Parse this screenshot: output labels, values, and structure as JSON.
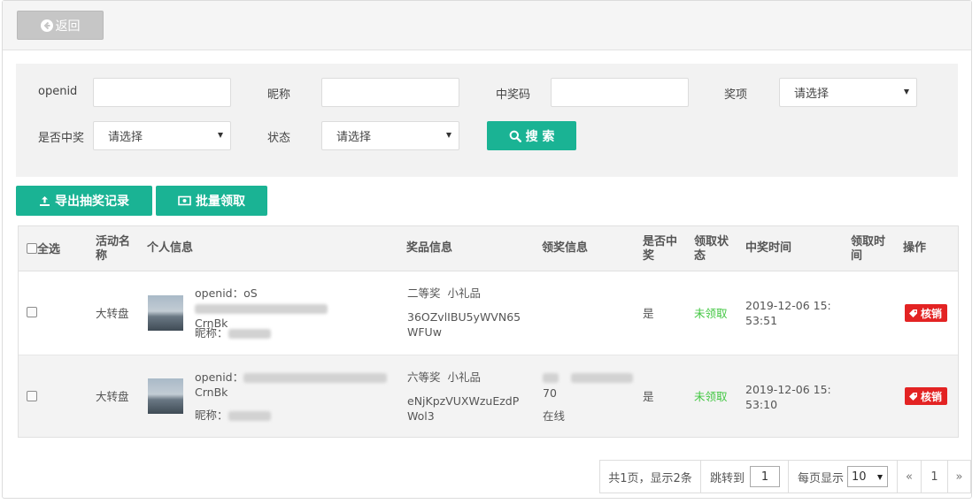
{
  "toolbar": {
    "back_label": "返回"
  },
  "search": {
    "openid_label": "openid",
    "nickname_label": "昵称",
    "code_label": "中奖码",
    "prize_label": "奖项",
    "prize_select": "请选择",
    "win_label": "是否中奖",
    "win_select": "请选择",
    "status_label": "状态",
    "status_select": "请选择",
    "search_button": "搜 索"
  },
  "actions": {
    "export_button": "导出抽奖记录",
    "batch_button": "批量领取"
  },
  "table": {
    "headers": {
      "select_all": "全选",
      "activity": "活动名称",
      "personal": "个人信息",
      "prize": "奖品信息",
      "claim": "领奖信息",
      "is_win": "是否中奖",
      "claim_status": "领取状态",
      "win_time": "中奖时间",
      "claim_time": "领取时间",
      "operation": "操作"
    },
    "rows": [
      {
        "activity": "大转盘",
        "openid_prefix": "openid：oS",
        "openid_suffix": "CrnBk",
        "nickname_prefix": "昵称：",
        "prize_name": "二等奖  小礼品",
        "prize_code": "36OZvlIBU5yWVN65WFUw",
        "claim_line2": "",
        "claim_line3": "",
        "is_win": "是",
        "status": "未领取",
        "win_time": "2019-12-06 15:53:51",
        "action": "核销"
      },
      {
        "activity": "大转盘",
        "openid_prefix": "openid：",
        "openid_suffix": "CrnBk",
        "nickname_prefix": "昵称：",
        "prize_name": "六等奖  小礼品",
        "prize_code": "eNjKpzVUXWzuEzdPWol3",
        "claim_line2": "70",
        "claim_line3": "在线",
        "is_win": "是",
        "status": "未领取",
        "win_time": "2019-12-06 15:53:10",
        "action": "核销"
      }
    ]
  },
  "pagination": {
    "summary": "共1页，显示2条",
    "jump_label": "跳转到",
    "jump_value": "1",
    "per_page_label": "每页显示",
    "per_page_value": "10",
    "prev": "«",
    "current_page": "1",
    "next": "»"
  },
  "colors": {
    "primary": "#1ab394",
    "danger": "#e32323",
    "status_unclaimed": "#43c743",
    "back_button": "#c6c6c6"
  }
}
